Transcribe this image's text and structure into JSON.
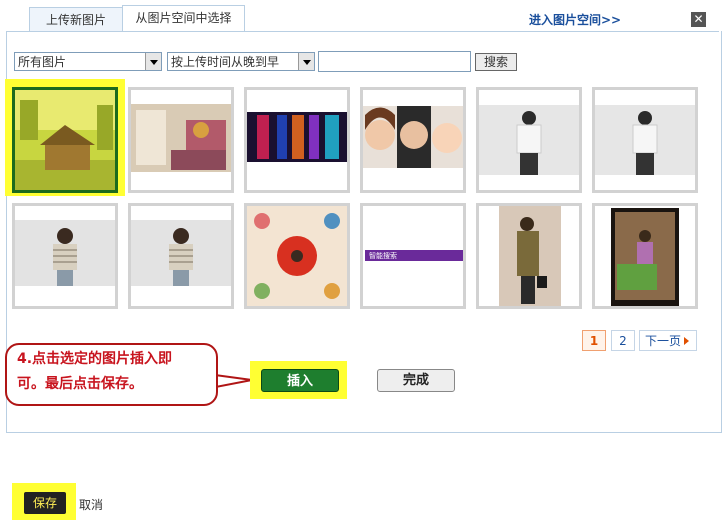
{
  "tabs": [
    {
      "label": "上传新图片",
      "active": false
    },
    {
      "label": "从图片空间中选择",
      "active": true
    }
  ],
  "space_link": "进入图片空间>>",
  "close_icon": "close-icon",
  "filters": {
    "category": "所有图片",
    "sort": "按上传时间从晚到早",
    "search_value": "",
    "search_button": "搜索"
  },
  "images": [
    {
      "description": "house painting",
      "selected": true
    },
    {
      "description": "shop interior",
      "selected": false
    },
    {
      "description": "colorful panorama",
      "selected": false
    },
    {
      "description": "three faces",
      "selected": false
    },
    {
      "description": "woman in white shirt",
      "selected": false
    },
    {
      "description": "woman in white shirt",
      "selected": false
    },
    {
      "description": "woman in striped sweater",
      "selected": false
    },
    {
      "description": "woman in striped sweater",
      "selected": false
    },
    {
      "description": "floral pattern",
      "selected": false
    },
    {
      "description": "purple banner",
      "selected": false
    },
    {
      "description": "woman in coat",
      "selected": false
    },
    {
      "description": "woman sitting",
      "selected": false
    }
  ],
  "banner_text": "智能搜索",
  "pagination": {
    "pages": [
      "1",
      "2"
    ],
    "current": "1",
    "next": "下一页"
  },
  "callout": {
    "line1": "4.点击选定的图片插入即",
    "line2": "可。最后点击保存。"
  },
  "insert_button": "插入",
  "done_button": "完成",
  "save_button": "保存",
  "cancel_link": "取消",
  "colors": {
    "highlight": "#ffff33",
    "insert_green": "#1e7e2e",
    "callout_red": "#c8141e"
  }
}
